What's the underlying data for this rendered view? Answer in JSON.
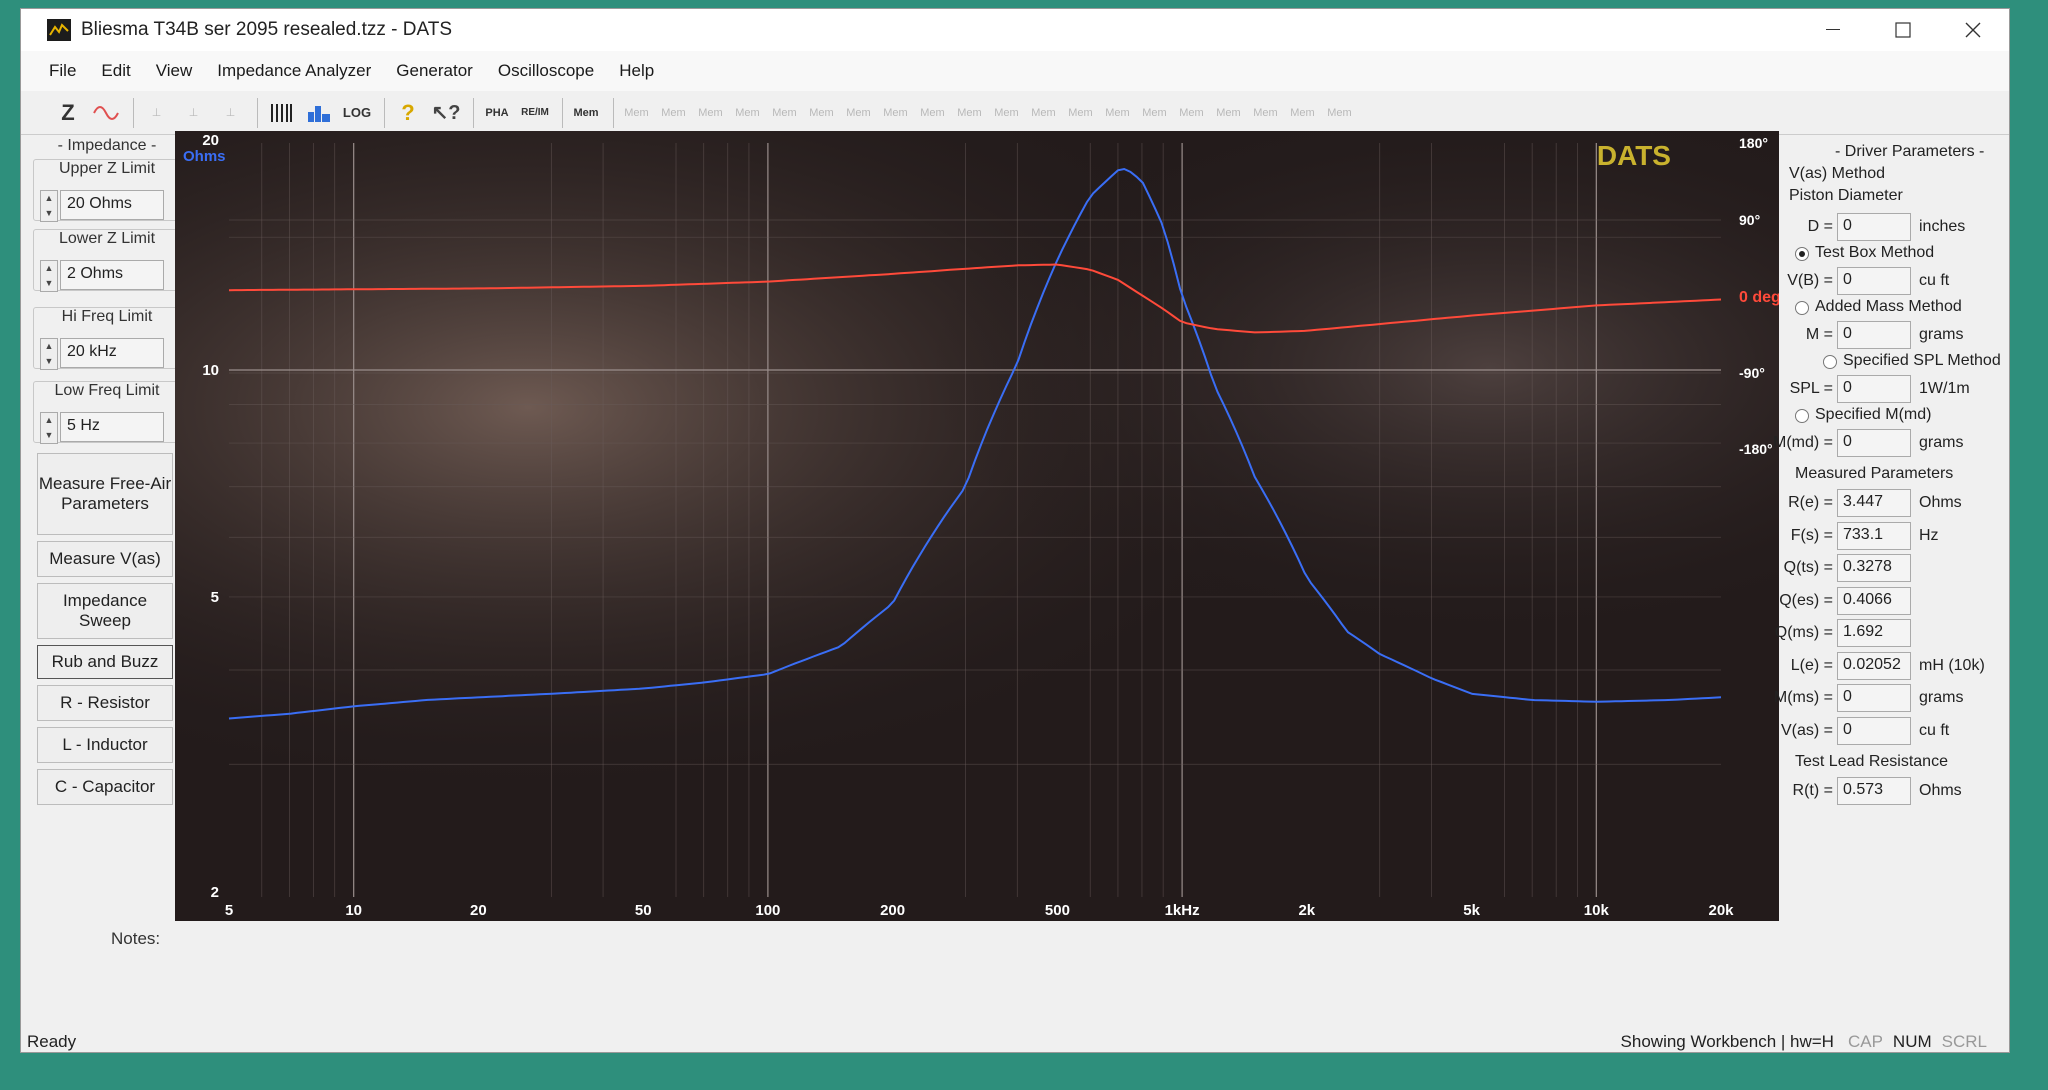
{
  "window": {
    "title": "Bliesma T34B ser 2095 resealed.tzz - DATS"
  },
  "menu": [
    "File",
    "Edit",
    "View",
    "Impedance Analyzer",
    "Generator",
    "Oscilloscope",
    "Help"
  ],
  "toolbar": {
    "z": "Z",
    "pha": "PHA",
    "reim": "RE/IM",
    "mem": "Mem",
    "mem_slots": [
      "Mem",
      "Mem",
      "Mem",
      "Mem",
      "Mem",
      "Mem",
      "Mem",
      "Mem",
      "Mem",
      "Mem",
      "Mem",
      "Mem",
      "Mem",
      "Mem",
      "Mem",
      "Mem",
      "Mem",
      "Mem",
      "Mem",
      "Mem"
    ]
  },
  "left": {
    "impedance_header": "- Impedance -",
    "upper_label": "Upper Z Limit",
    "upper_value": "20 Ohms",
    "lower_label": "Lower Z Limit",
    "lower_value": "2 Ohms",
    "hifreq_label": "Hi Freq Limit",
    "hifreq_value": "20 kHz",
    "lowfreq_label": "Low Freq Limit",
    "lowfreq_value": "5 Hz",
    "btn_free_air": "Measure Free-Air Parameters",
    "btn_vas": "Measure V(as)",
    "btn_sweep": "Impedance Sweep",
    "btn_rub": "Rub and Buzz",
    "btn_r": "R - Resistor",
    "btn_l": "L - Inductor",
    "btn_c": "C - Capacitor"
  },
  "chart_data": {
    "type": "line",
    "brand": "DATS",
    "ylabel": "Ohms",
    "y_ticks": [
      "20",
      "10",
      "5",
      "2"
    ],
    "y2_ticks": [
      "180°",
      "90°",
      "0 deg",
      "-90°",
      "-180°"
    ],
    "x_ticks": [
      "5",
      "10",
      "20",
      "50",
      "100",
      "200",
      "500",
      "1kHz",
      "2k",
      "5k",
      "10k",
      "20k"
    ],
    "xlim": [
      5,
      20000
    ],
    "ylim": [
      2,
      20
    ],
    "y2lim": [
      -180,
      180
    ],
    "x_scale": "log",
    "y_scale": "log",
    "series": [
      {
        "key": "impedance",
        "color": "#3a6ef5",
        "x": [
          5,
          7,
          10,
          15,
          20,
          30,
          50,
          70,
          100,
          150,
          200,
          300,
          400,
          500,
          600,
          700,
          733,
          800,
          900,
          1000,
          1200,
          1500,
          2000,
          2500,
          3000,
          4000,
          5000,
          7000,
          10000,
          15000,
          20000
        ],
        "y": [
          3.45,
          3.5,
          3.58,
          3.65,
          3.68,
          3.72,
          3.78,
          3.85,
          3.95,
          4.3,
          4.9,
          7.0,
          10.2,
          14.0,
          17.0,
          18.4,
          18.5,
          17.8,
          15.5,
          12.5,
          9.5,
          7.2,
          5.3,
          4.5,
          4.2,
          3.9,
          3.72,
          3.65,
          3.63,
          3.65,
          3.68
        ]
      },
      {
        "key": "phase",
        "color": "#ff4a3a",
        "x": [
          5,
          10,
          20,
          50,
          100,
          200,
          300,
          400,
          500,
          600,
          700,
          800,
          900,
          1000,
          1200,
          1500,
          2000,
          3000,
          5000,
          10000,
          20000
        ],
        "y": [
          8,
          9,
          10,
          13,
          18,
          27,
          33,
          37,
          38,
          32,
          20,
          2,
          -14,
          -30,
          -38,
          -42,
          -40,
          -32,
          -22,
          -10,
          -3
        ]
      }
    ]
  },
  "driver": {
    "title": "- Driver Parameters -",
    "vas_method": "V(as) Method",
    "piston_diameter": "Piston Diameter",
    "d_label": "D =",
    "d_value": "0",
    "d_unit": "inches",
    "test_box": "Test Box Method",
    "vb_label": "V(B) =",
    "vb_value": "0",
    "vb_unit": "cu ft",
    "added_mass": "Added Mass Method",
    "m_label": "M =",
    "m_value": "0",
    "m_unit": "grams",
    "spl_method": "Specified SPL Method",
    "spl_label": "SPL =",
    "spl_value": "0",
    "spl_unit": "1W/1m",
    "mmd_method": "Specified M(md)",
    "mmd_label": "M(md) =",
    "mmd_value": "0",
    "mmd_unit": "grams"
  },
  "measured": {
    "title": "Measured Parameters",
    "rows": [
      {
        "label": "R(e) =",
        "value": "3.447",
        "unit": "Ohms"
      },
      {
        "label": "F(s) =",
        "value": "733.1",
        "unit": "Hz"
      },
      {
        "label": "Q(ts) =",
        "value": "0.3278",
        "unit": ""
      },
      {
        "label": "Q(es) =",
        "value": "0.4066",
        "unit": ""
      },
      {
        "label": "Q(ms) =",
        "value": "1.692",
        "unit": ""
      },
      {
        "label": "L(e) =",
        "value": "0.02052",
        "unit": "mH (10k)"
      },
      {
        "label": "M(ms) =",
        "value": "0",
        "unit": "grams"
      },
      {
        "label": "V(as) =",
        "value": "0",
        "unit": "cu ft"
      }
    ]
  },
  "testlead": {
    "title": "Test Lead Resistance",
    "label": "R(t) =",
    "value": "0.573",
    "unit": "Ohms"
  },
  "notes_label": "Notes:",
  "status": {
    "left": "Ready",
    "right": "Showing Workbench | hw=H",
    "cap": "CAP",
    "num": "NUM",
    "scrl": "SCRL"
  }
}
